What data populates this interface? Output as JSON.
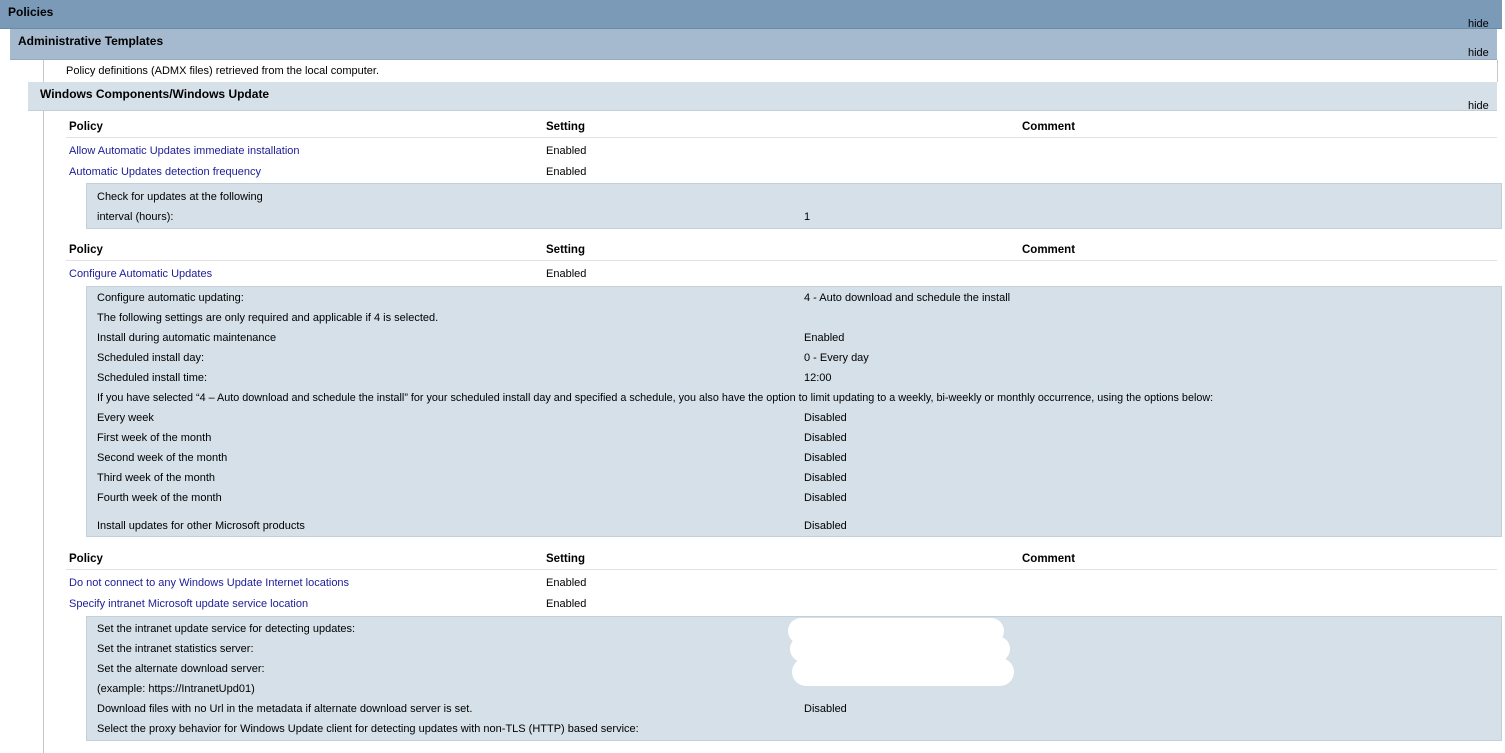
{
  "header": {
    "title": "Policies",
    "hide_label": "hide"
  },
  "admin_templates": {
    "title": "Administrative Templates",
    "hide_label": "hide",
    "description": "Policy definitions (ADMX files) retrieved from the local computer."
  },
  "component": {
    "title": "Windows Components/Windows Update",
    "hide_label": "hide"
  },
  "table_headers": {
    "policy": "Policy",
    "setting": "Setting",
    "comment": "Comment"
  },
  "group1": {
    "rows": [
      {
        "policy": "Allow Automatic Updates immediate installation",
        "setting": "Enabled"
      },
      {
        "policy": "Automatic Updates detection frequency",
        "setting": "Enabled"
      }
    ],
    "details": [
      {
        "label": "Check for updates at the following",
        "value": ""
      },
      {
        "label": "interval (hours):",
        "value": "1"
      }
    ]
  },
  "group2": {
    "rows": [
      {
        "policy": "Configure Automatic Updates",
        "setting": "Enabled"
      }
    ],
    "details": [
      {
        "label": "Configure automatic updating:",
        "value": "4 - Auto download and schedule the install"
      },
      {
        "label": "The following settings are only required and applicable if 4 is selected.",
        "value": ""
      },
      {
        "label": "Install during automatic maintenance",
        "value": "Enabled"
      },
      {
        "label": "Scheduled install day:",
        "value": "0 - Every day"
      },
      {
        "label": "Scheduled install time:",
        "value": "12:00"
      },
      {
        "label": "If you have selected “4 – Auto download and schedule the install” for your scheduled install day and specified a schedule, you also have the option to limit updating to a weekly, bi-weekly or monthly occurrence, using the options below:",
        "value": ""
      },
      {
        "label": "Every week",
        "value": "Disabled"
      },
      {
        "label": "First week of the month",
        "value": "Disabled"
      },
      {
        "label": "Second week of the month",
        "value": "Disabled"
      },
      {
        "label": "Third week of the month",
        "value": "Disabled"
      },
      {
        "label": "Fourth week of the month",
        "value": "Disabled"
      },
      {
        "label": "Install updates for other Microsoft products",
        "value": "Disabled"
      }
    ]
  },
  "group3": {
    "rows": [
      {
        "policy": "Do not connect to any Windows Update Internet locations",
        "setting": "Enabled"
      },
      {
        "policy": "Specify intranet Microsoft update service location",
        "setting": "Enabled"
      }
    ],
    "details": [
      {
        "label": "Set the intranet update service for detecting updates:",
        "value": ""
      },
      {
        "label": "Set the intranet statistics server:",
        "value": ""
      },
      {
        "label": "Set the alternate download server:",
        "value": ""
      },
      {
        "label": "(example: https://IntranetUpd01)",
        "value": ""
      },
      {
        "label": "Download files with no Url in the metadata if alternate download server is set.",
        "value": "Disabled"
      },
      {
        "label": "Select the proxy behavior for Windows Update client for detecting updates with non-TLS (HTTP) based service:",
        "value": ""
      }
    ]
  }
}
